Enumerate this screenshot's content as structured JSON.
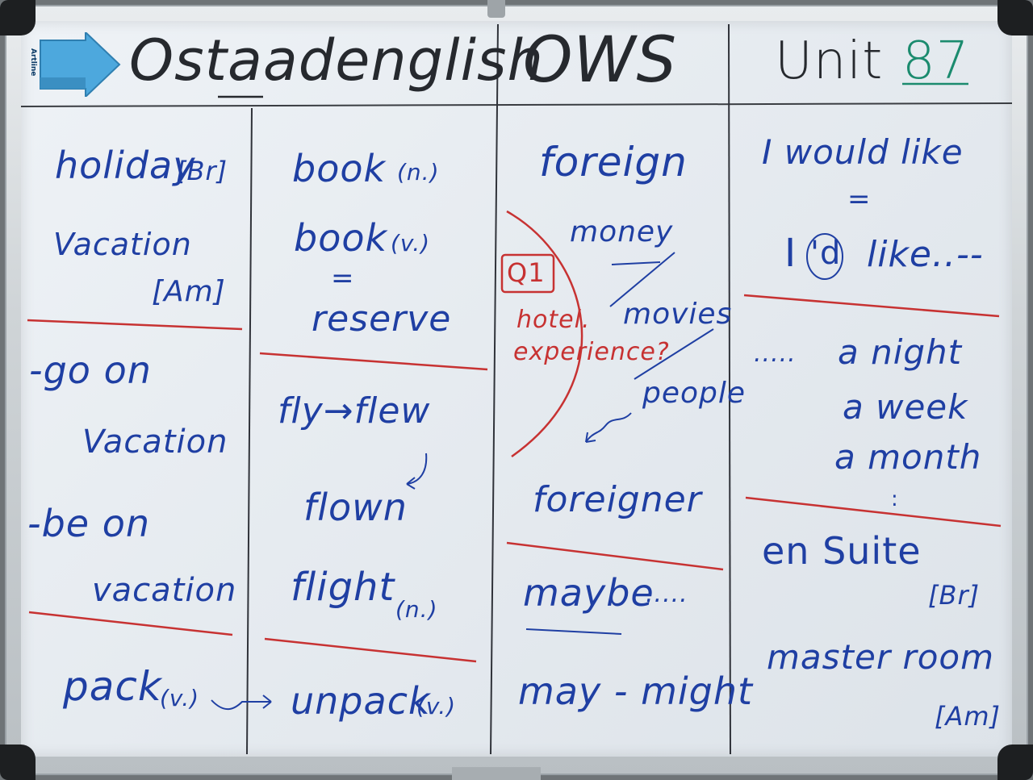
{
  "colors": {
    "blue_marker": "#1f3fa3",
    "black_marker": "#26292e",
    "red_marker": "#c73232",
    "green_marker": "#1b8b6e",
    "board": "#e6ebf0",
    "eraser": "#4da8dd"
  },
  "eraser": {
    "brand": "Artline"
  },
  "header": {
    "brand": "Ostaadenglish",
    "course": "OWS",
    "unit_label": "Unit",
    "unit_number": "87"
  },
  "col1": {
    "holiday": "holiday",
    "br": "[Br]",
    "vacation": "Vacation",
    "am": "[Am]",
    "go_on": "-go on",
    "vacation2": "Vacation",
    "be_on": "-be on",
    "vacation3": "vacation",
    "pack": "pack",
    "pack_v": "(v.)"
  },
  "col2": {
    "book_n": "book",
    "n": "(n.)",
    "book_v": "book",
    "v": "(v.)",
    "equals": "=",
    "reserve": "reserve",
    "fly_flew": "fly→flew",
    "flown": "flown",
    "flight": "flight",
    "flight_n": "(n.)",
    "unpack": "unpack",
    "unpack_v": "(v.)"
  },
  "col3": {
    "foreign": "foreign",
    "money": "money",
    "q1": "Q1",
    "hotel": "hotel.",
    "movies": "movies",
    "experience": "experience?",
    "people": "people",
    "foreigner": "foreigner",
    "maybe": "maybe",
    "dots": ".....",
    "may_might": "may - might"
  },
  "col4": {
    "i_would_like": "I would like",
    "equals": "=",
    "id_like_i": "I",
    "id_like_d": "'d",
    "like": "like..--",
    "dots": ".....",
    "a_night": "a night",
    "a_week": "a week",
    "a_month": "a month",
    "vdots": ":",
    "en_suite": "en Suite",
    "br": "[Br]",
    "master_room": "master room",
    "am": "[Am]"
  }
}
